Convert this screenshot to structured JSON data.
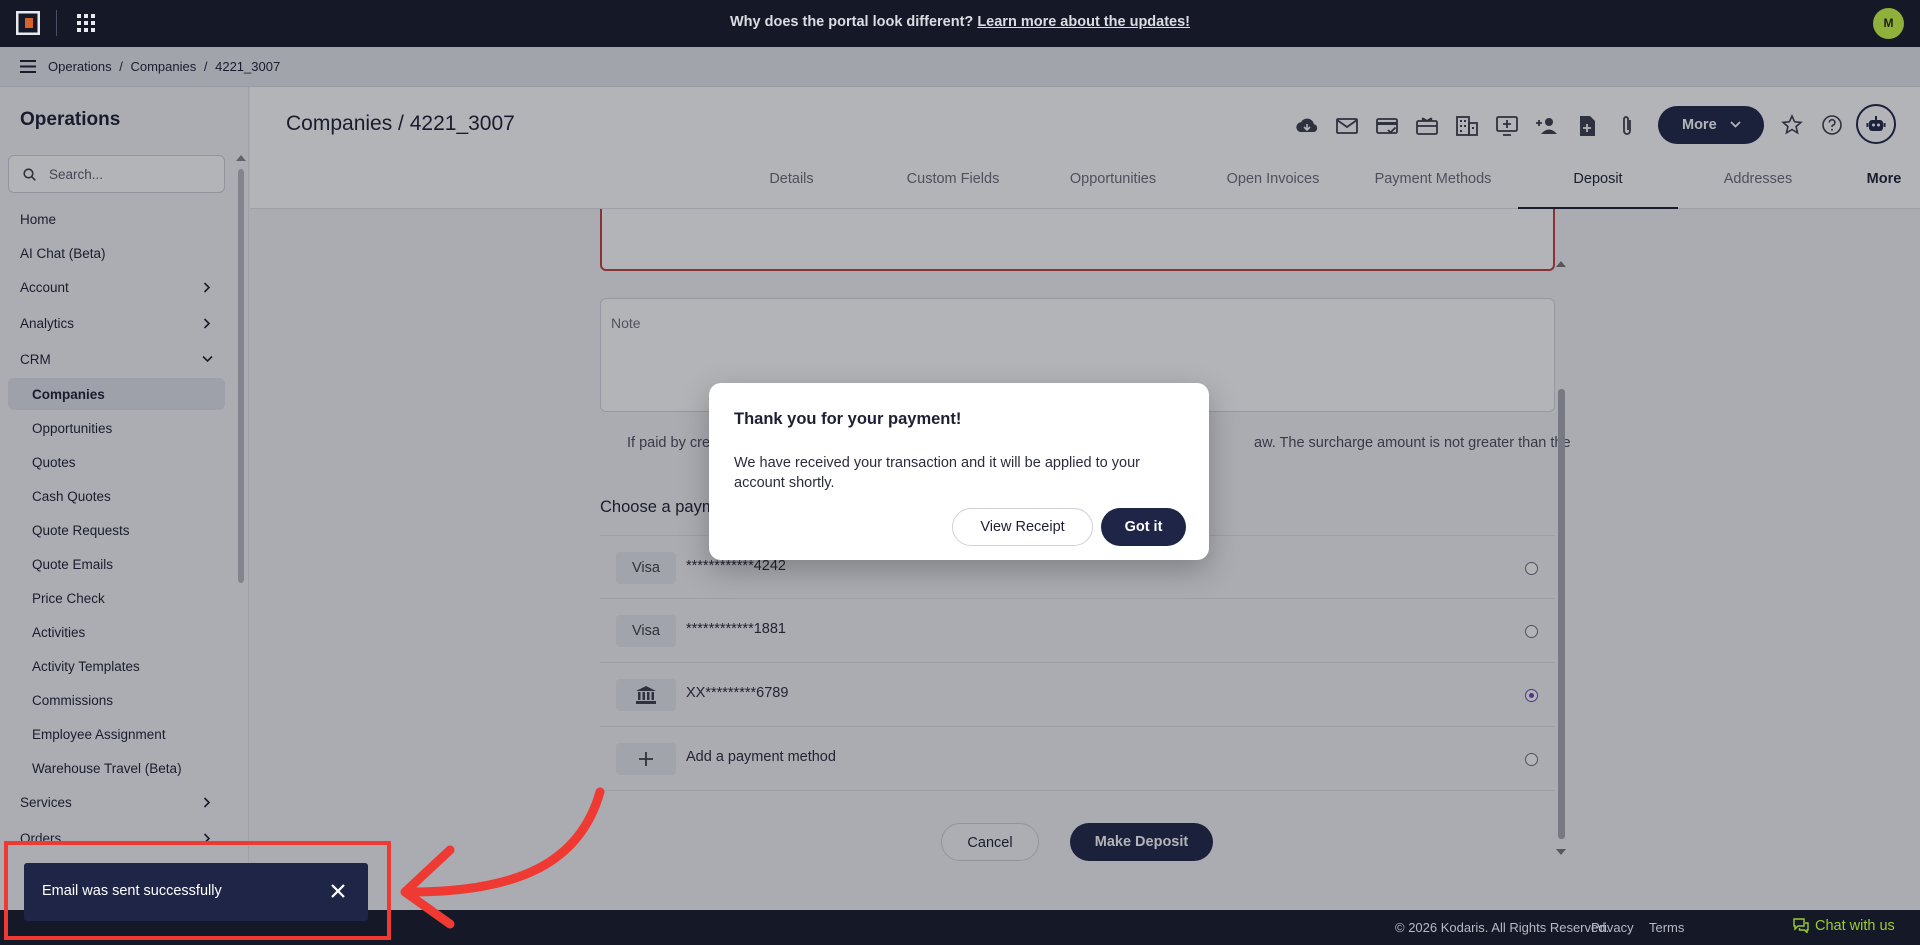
{
  "topbar": {
    "announcement_prefix": "Why does the portal look different?",
    "announcement_link": "Learn more about the updates!",
    "user_initial": "M"
  },
  "breadcrumb": [
    "Operations",
    "/",
    "Companies",
    "/",
    "4221_3007"
  ],
  "sidebar": {
    "title": "Operations",
    "search_placeholder": "Search...",
    "items": [
      {
        "label": "Home",
        "type": "top"
      },
      {
        "label": "AI Chat (Beta)",
        "type": "top"
      },
      {
        "label": "Account",
        "type": "group",
        "expanded": false
      },
      {
        "label": "Analytics",
        "type": "group",
        "expanded": false
      },
      {
        "label": "CRM",
        "type": "group",
        "expanded": true
      },
      {
        "label": "Companies",
        "type": "sub",
        "active": true
      },
      {
        "label": "Opportunities",
        "type": "sub"
      },
      {
        "label": "Quotes",
        "type": "sub"
      },
      {
        "label": "Cash Quotes",
        "type": "sub"
      },
      {
        "label": "Quote Requests",
        "type": "sub"
      },
      {
        "label": "Quote Emails",
        "type": "sub"
      },
      {
        "label": "Price Check",
        "type": "sub"
      },
      {
        "label": "Activities",
        "type": "sub"
      },
      {
        "label": "Activity Templates",
        "type": "sub"
      },
      {
        "label": "Commissions",
        "type": "sub"
      },
      {
        "label": "Employee Assignment",
        "type": "sub"
      },
      {
        "label": "Warehouse Travel (Beta)",
        "type": "sub"
      },
      {
        "label": "Services",
        "type": "group",
        "expanded": false
      },
      {
        "label": "Orders",
        "type": "group",
        "expanded": false
      }
    ]
  },
  "header": {
    "title": "Companies / 4221_3007",
    "icons": [
      "cloud-icon",
      "mail-icon",
      "card-check-icon",
      "gift-card-icon",
      "building-icon",
      "monitor-plus-icon",
      "add-person-icon",
      "file-plus-icon",
      "paperclip-icon"
    ],
    "more_label": "More"
  },
  "tabs": [
    {
      "label": "Details"
    },
    {
      "label": "Custom Fields"
    },
    {
      "label": "Opportunities"
    },
    {
      "label": "Open Invoices"
    },
    {
      "label": "Payment Methods"
    },
    {
      "label": "Deposit",
      "active": true
    },
    {
      "label": "Addresses"
    },
    {
      "label": "More"
    }
  ],
  "deposit": {
    "note_placeholder": "Note",
    "surcharge_left": "If paid by cre",
    "surcharge_right": "aw. The surcharge amount is not greater than the",
    "choose_label": "Choose a paym",
    "payment_methods": [
      {
        "badge": "Visa",
        "number": "************4242",
        "selected": false
      },
      {
        "badge": "Visa",
        "number": "************1881",
        "selected": false
      },
      {
        "badge": "bank-icon",
        "number": "XX*********6789",
        "selected": true
      },
      {
        "badge": "plus-icon",
        "number": "Add a payment method",
        "selected": false
      }
    ],
    "cancel_label": "Cancel",
    "submit_label": "Make Deposit"
  },
  "modal": {
    "title": "Thank you for your payment!",
    "body": "We have received your transaction and it will be applied to your account shortly.",
    "view_receipt_label": "View Receipt",
    "got_it_label": "Got it"
  },
  "toast": {
    "message": "Email was sent successfully"
  },
  "footer": {
    "copyright": "© 2026 Kodaris. All Rights Reserved.",
    "privacy": "Privacy",
    "terms": "Terms",
    "chat": "Chat with us"
  },
  "colors": {
    "navy": "#1f2547",
    "topbar": "#151827",
    "highlight": "#ee3a32",
    "chat_green": "#9acd32",
    "radio_selected": "#6a45b8"
  }
}
